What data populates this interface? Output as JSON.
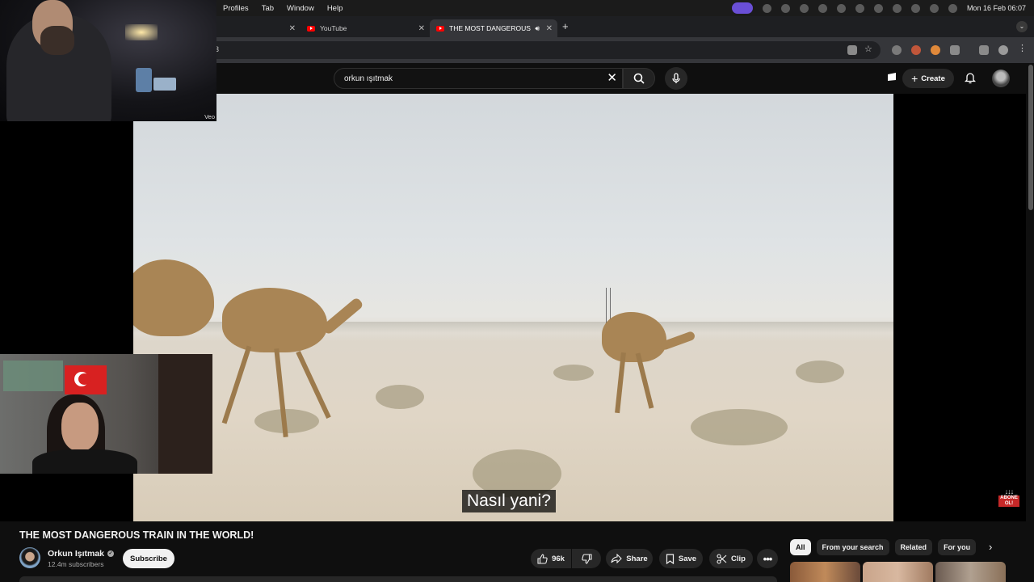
{
  "menubar": {
    "items": [
      "Profiles",
      "Tab",
      "Window",
      "Help"
    ],
    "clock": "Mon 16 Feb  06:07"
  },
  "browser": {
    "tabs": [
      {
        "label": ""
      },
      {
        "label": "YouTube"
      },
      {
        "label": "THE MOST DANGEROUS"
      }
    ],
    "new_tab": "+",
    "address_fragment": "3"
  },
  "youtube": {
    "search": {
      "value": "orkun ışıtmak"
    },
    "create_label": "Create"
  },
  "video": {
    "subtitle": "Nasıl yani?",
    "cam_watermark": "Veo",
    "abone_badge": "ABONE OL!",
    "abone_arrows": "↓↓↓"
  },
  "watch": {
    "title": "THE MOST DANGEROUS TRAIN IN THE WORLD!",
    "channel": "Orkun Işıtmak",
    "subscribers": "12.4m subscribers",
    "subscribe_label": "Subscribe",
    "likes": "96k",
    "share_label": "Share",
    "save_label": "Save",
    "clip_label": "Clip"
  },
  "related_chips": [
    "All",
    "From your search",
    "Related",
    "For you"
  ],
  "colors": {
    "yt_red": "#ff0000",
    "bg": "#0f0f0f",
    "chip_selected": "#f1f1f1"
  }
}
